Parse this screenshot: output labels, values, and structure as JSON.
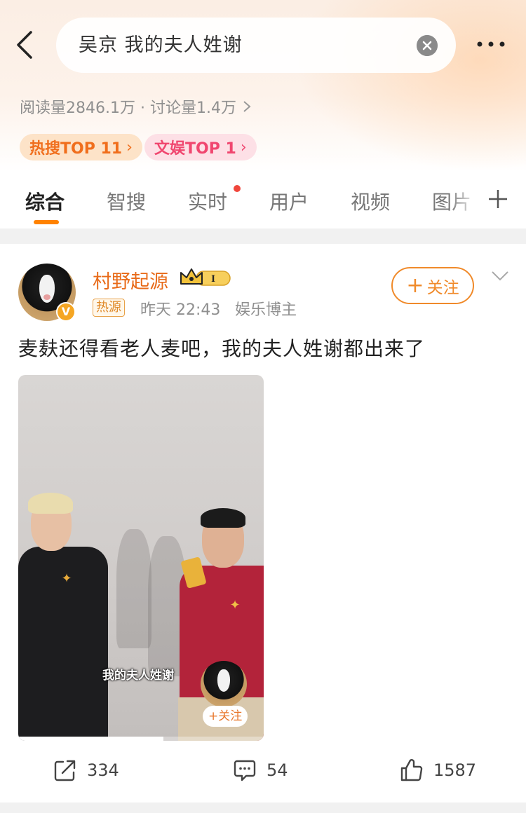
{
  "header": {
    "search_query": "吴京 我的夫人姓谢",
    "stats_text": "阅读量2846.1万 · 讨论量1.4万",
    "badges": [
      {
        "label": "热搜TOP 11",
        "arrow": "›"
      },
      {
        "label": "文娱TOP 1",
        "arrow": "›"
      }
    ]
  },
  "tabs": [
    {
      "label": "综合",
      "active": true
    },
    {
      "label": "智搜",
      "active": false
    },
    {
      "label": "实时",
      "active": false,
      "dot": true
    },
    {
      "label": "用户",
      "active": false
    },
    {
      "label": "视频",
      "active": false
    },
    {
      "label": "图片",
      "active": false
    }
  ],
  "post": {
    "user_name": "村野起源",
    "verified_badge": "V",
    "level_badge": "I",
    "tag": "热源",
    "time": "昨天 22:43",
    "role": "娱乐博主",
    "follow_label": "关注",
    "text": "麦麸还得看老人麦吧，我的夫人姓谢都出来了",
    "video": {
      "caption": "我的夫人姓谢",
      "follow_label": "+关注",
      "progress": 0.59
    },
    "actions": {
      "repost_count": "334",
      "comment_count": "54",
      "like_count": "1587"
    }
  },
  "colors": {
    "accent_orange": "#ff8200",
    "user_name": "#e86b1a",
    "hot_badge": "#f06e1c",
    "ent_badge": "#f0466f"
  },
  "icons": [
    "back-arrow-icon",
    "clear-icon",
    "more-icon",
    "chevron-right-icon",
    "plus-icon",
    "crown-icon",
    "chevron-down-icon",
    "share-icon",
    "comment-icon",
    "like-icon"
  ]
}
